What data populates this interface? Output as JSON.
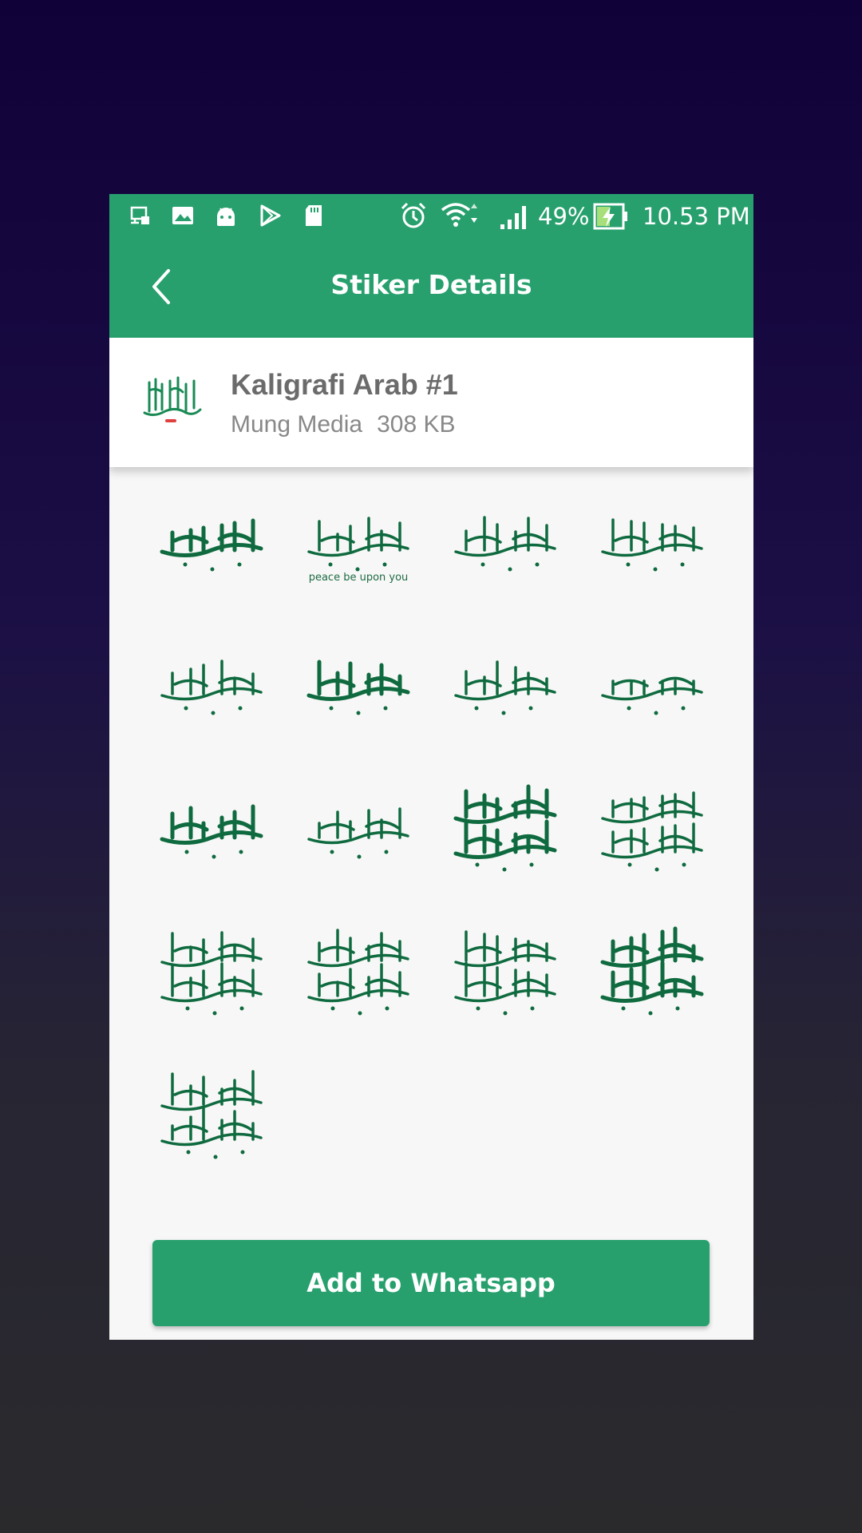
{
  "status_bar": {
    "battery_percent": "49%",
    "time": "10.53 PM",
    "icons": [
      "screen-cast-icon",
      "gallery-icon",
      "android-icon",
      "play-store-icon",
      "sd-card-icon",
      "alarm-icon",
      "wifi-icon",
      "signal-icon",
      "battery-charging-icon"
    ]
  },
  "toolbar": {
    "title": "Stiker Details",
    "back_icon": "chevron-left-icon"
  },
  "pack": {
    "title": "Kaligrafi Arab #1",
    "publisher": "Mung Media",
    "size": "308 KB"
  },
  "stickers": [
    {
      "id": "basmala"
    },
    {
      "id": "assalamualaikum",
      "caption": "peace be upon you"
    },
    {
      "id": "hadza-min-fadli-rabbi"
    },
    {
      "id": "alhamdulillah"
    },
    {
      "id": "salla-allahu-alayhi-wasallam-round"
    },
    {
      "id": "allahu-akbar"
    },
    {
      "id": "salla-allahu-alayhi-wasallam"
    },
    {
      "id": "sadaqallahul-azim"
    },
    {
      "id": "muhammad"
    },
    {
      "id": "shahada"
    },
    {
      "id": "amin-ya-rabbal-alamin"
    },
    {
      "id": "subhanallah"
    },
    {
      "id": "inna-lillahi"
    },
    {
      "id": "barakallahu-laka"
    },
    {
      "id": "bismillahi-majreha"
    },
    {
      "id": "barakallah-fi-amrik"
    },
    {
      "id": "fi-amanillah"
    }
  ],
  "add_button": {
    "label": "Add to Whatsapp"
  },
  "colors": {
    "primary": "#27a06d",
    "calligraphy": "#0f6b3f",
    "header_text": "#6b6b6b",
    "meta_text": "#888888"
  }
}
